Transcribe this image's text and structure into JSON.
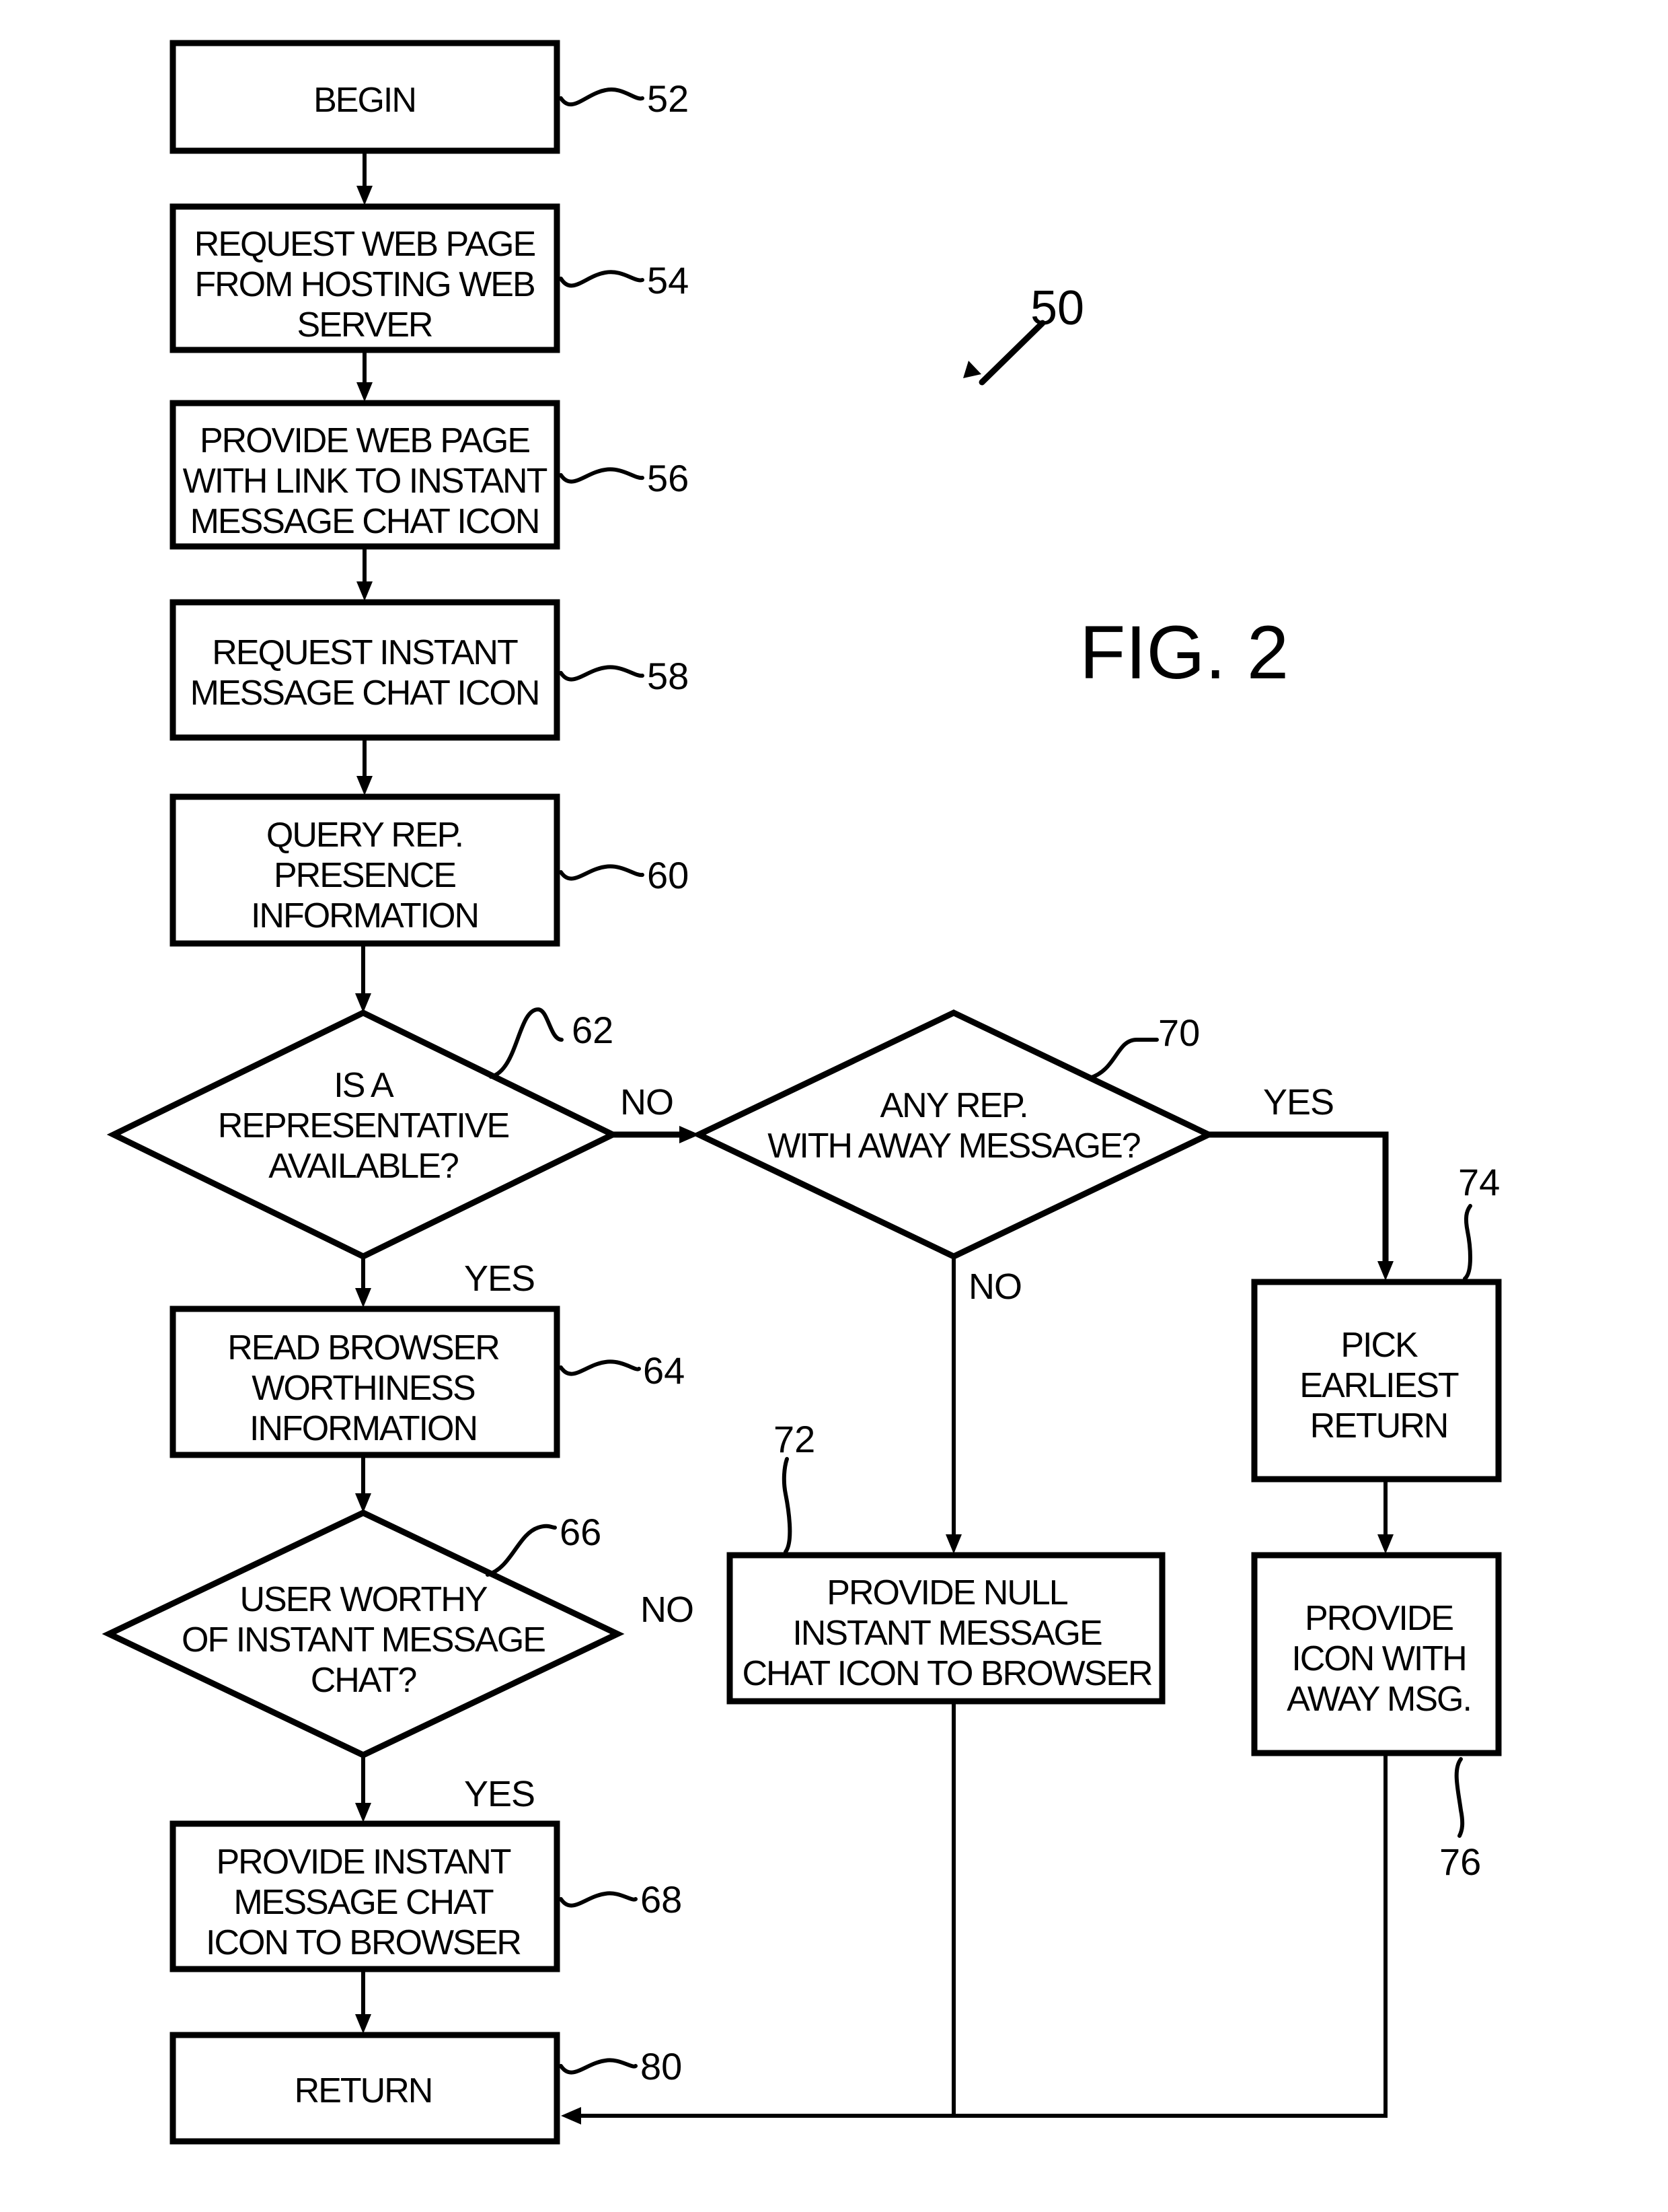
{
  "figure": {
    "title": "FIG. 2",
    "reference": "50"
  },
  "nodes": {
    "begin": {
      "ref": "52",
      "lines": [
        "BEGIN"
      ]
    },
    "request_page": {
      "ref": "54",
      "lines": [
        "REQUEST WEB PAGE",
        "FROM HOSTING WEB",
        "SERVER"
      ]
    },
    "provide_page": {
      "ref": "56",
      "lines": [
        "PROVIDE WEB PAGE",
        "WITH LINK TO  INSTANT",
        "MESSAGE CHAT ICON"
      ]
    },
    "request_icon": {
      "ref": "58",
      "lines": [
        "REQUEST INSTANT",
        "MESSAGE CHAT ICON"
      ]
    },
    "query_presence": {
      "ref": "60",
      "lines": [
        "QUERY REP.",
        "PRESENCE",
        "INFORMATION"
      ]
    },
    "rep_available": {
      "ref": "62",
      "lines": [
        "IS A",
        "REPRESENTATIVE",
        "AVAILABLE?"
      ]
    },
    "away_message": {
      "ref": "70",
      "lines": [
        "ANY REP.",
        "WITH AWAY MESSAGE?"
      ]
    },
    "read_worthiness": {
      "ref": "64",
      "lines": [
        "READ BROWSER",
        "WORTHINESS",
        "INFORMATION"
      ]
    },
    "user_worthy": {
      "ref": "66",
      "lines": [
        "USER WORTHY",
        "OF INSTANT MESSAGE",
        "CHAT?"
      ]
    },
    "provide_icon": {
      "ref": "68",
      "lines": [
        "PROVIDE INSTANT",
        "MESSAGE CHAT",
        "ICON TO BROWSER"
      ]
    },
    "return": {
      "ref": "80",
      "lines": [
        "RETURN"
      ]
    },
    "null_icon": {
      "ref": "72",
      "lines": [
        "PROVIDE NULL",
        "INSTANT MESSAGE",
        "CHAT ICON TO BROWSER"
      ]
    },
    "earliest_return": {
      "ref": "74",
      "lines": [
        "PICK",
        "EARLIEST",
        "RETURN"
      ]
    },
    "icon_away": {
      "ref": "76",
      "lines": [
        "PROVIDE",
        "ICON WITH",
        "AWAY MSG."
      ]
    }
  },
  "edge_labels": {
    "rep_available_no": "NO",
    "rep_available_yes": "YES",
    "away_yes": "YES",
    "away_no": "NO",
    "user_worthy_no": "NO",
    "user_worthy_yes": "YES"
  }
}
